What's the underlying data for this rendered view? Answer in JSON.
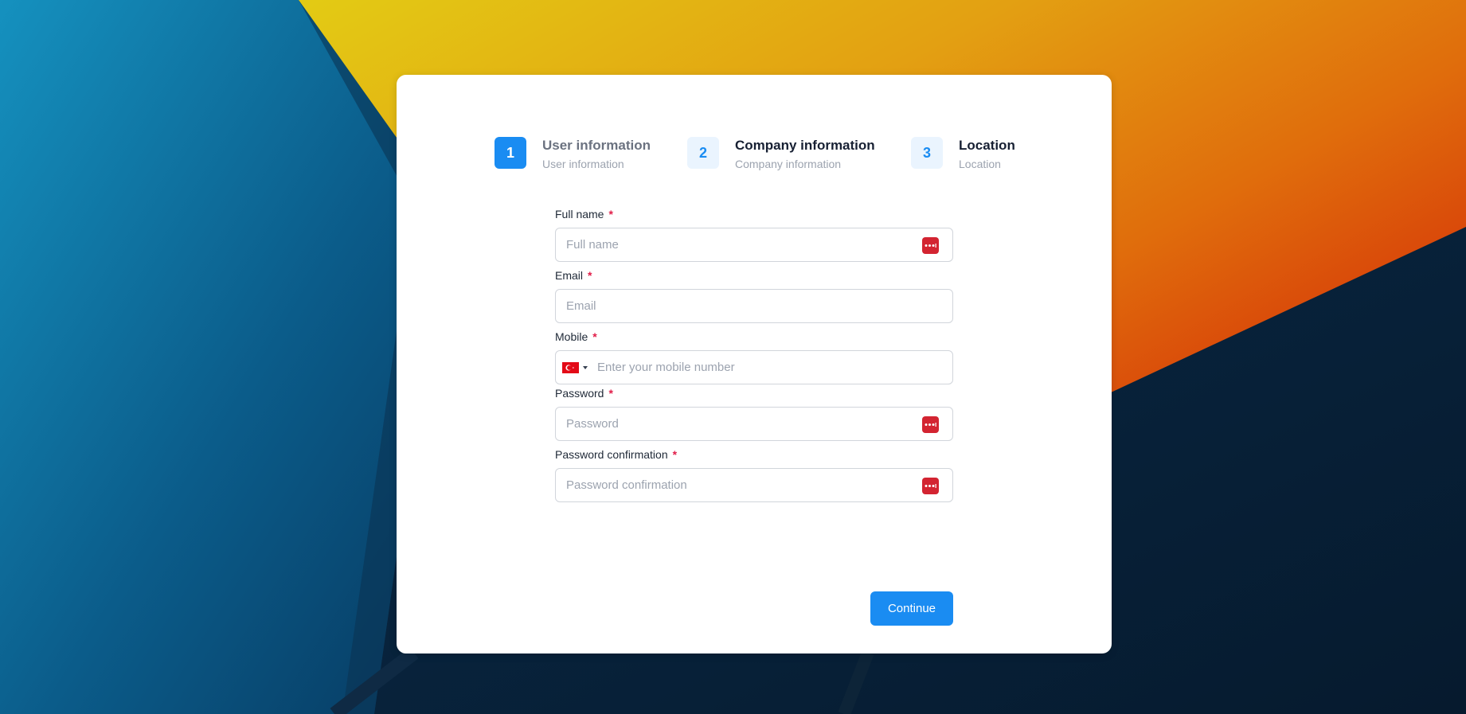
{
  "steps": [
    {
      "number": "1",
      "title": "User information",
      "subtitle": "User information",
      "state": "active"
    },
    {
      "number": "2",
      "title": "Company information",
      "subtitle": "Company information",
      "state": "upcoming"
    },
    {
      "number": "3",
      "title": "Location",
      "subtitle": "Location",
      "state": "upcoming"
    }
  ],
  "form": {
    "full_name": {
      "label": "Full name",
      "required_mark": "*",
      "placeholder": "Full name",
      "value": ""
    },
    "email": {
      "label": "Email",
      "required_mark": "*",
      "placeholder": "Email",
      "value": ""
    },
    "mobile": {
      "label": "Mobile",
      "required_mark": "*",
      "placeholder": "Enter your mobile number",
      "value": "",
      "country_flag": "turkey-flag-icon"
    },
    "password": {
      "label": "Password",
      "required_mark": "*",
      "placeholder": "Password",
      "value": ""
    },
    "password_confirmation": {
      "label": "Password confirmation",
      "required_mark": "*",
      "placeholder": "Password confirmation",
      "value": ""
    },
    "continue_label": "Continue"
  },
  "icons": {
    "password_manager": "password-manager-icon"
  },
  "colors": {
    "accent": "#1a8cf2",
    "step_inactive_bg": "#eaf4fe",
    "required": "#e11d48",
    "password_manager": "#d32431",
    "flag": "#e30a17"
  }
}
